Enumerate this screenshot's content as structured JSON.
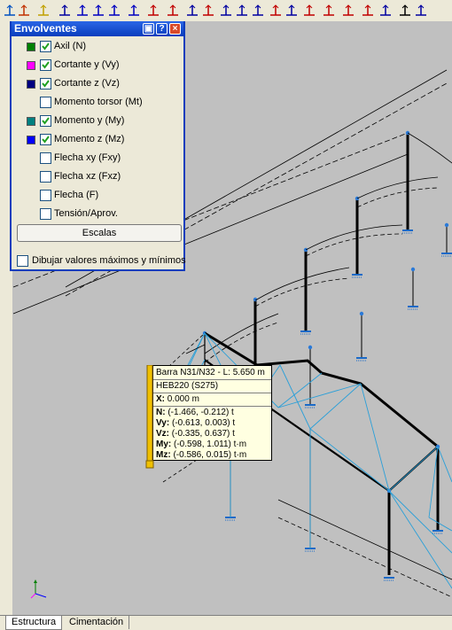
{
  "panel": {
    "title": "Envolventes",
    "items": [
      {
        "label": "Axil (N)",
        "checked": true,
        "color": "#008000"
      },
      {
        "label": "Cortante y (Vy)",
        "checked": true,
        "color": "#ff00ff"
      },
      {
        "label": "Cortante z (Vz)",
        "checked": true,
        "color": "#000080"
      },
      {
        "label": "Momento torsor (Mt)",
        "checked": false,
        "color": null
      },
      {
        "label": "Momento y (My)",
        "checked": true,
        "color": "#008080"
      },
      {
        "label": "Momento z (Mz)",
        "checked": true,
        "color": "#0000ff"
      },
      {
        "label": "Flecha xy (Fxy)",
        "checked": false,
        "color": null
      },
      {
        "label": "Flecha xz (Fxz)",
        "checked": false,
        "color": null
      },
      {
        "label": "Flecha (F)",
        "checked": false,
        "color": null
      },
      {
        "label": "Tensión/Aprov.",
        "checked": false,
        "color": null
      }
    ],
    "scales_button": "Escalas",
    "draw_maxmin_label": "Dibujar valores máximos y mínimos",
    "draw_maxmin_checked": false
  },
  "tooltip": {
    "bar": "Barra N31/N32 - L: 5.650 m",
    "profile": "HEB220 (S275)",
    "x_key": "X:",
    "x_val": "0.000 m",
    "values": [
      {
        "key": "N:",
        "val": "(-1.466, -0.212) t"
      },
      {
        "key": "Vy:",
        "val": "(-0.613, 0.003) t"
      },
      {
        "key": "Vz:",
        "val": "(-0.335, 0.637) t"
      },
      {
        "key": "My:",
        "val": "(-0.598, 1.011) t·m"
      },
      {
        "key": "Mz:",
        "val": "(-0.586, 0.015) t·m"
      }
    ]
  },
  "tabs": [
    "Estructura",
    "Cimentación"
  ],
  "toolbar_icons": [
    "refresh-icon",
    "load-icon",
    "note-icon",
    "select-icon",
    "dimension-icon",
    "grid-icon",
    "node-icon",
    "move-icon",
    "support-icon",
    "hinge-icon",
    "pencil-icon",
    "beam-icon",
    "joint-icon",
    "link-icon",
    "split-icon",
    "bar-icon",
    "chart-icon",
    "table-icon",
    "load-arrows-icon",
    "load-distributed-icon",
    "load-x-icon",
    "result-icon",
    "brush-icon",
    "frame-icon"
  ]
}
